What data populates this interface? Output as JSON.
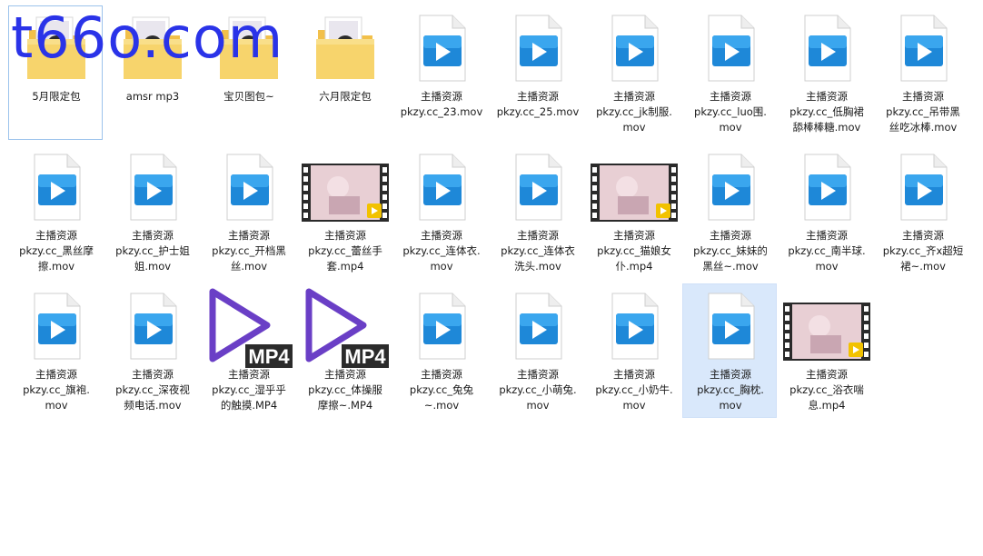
{
  "watermark": "t66o.com",
  "colors": {
    "selection": "#d9e8fb",
    "video_blue": "#1e88d8",
    "mp4_purple": "#6a3fc6",
    "folder": "#f6cf62",
    "watermark": "#2a33e8"
  },
  "items": [
    {
      "type": "folder",
      "lines": [
        "5月限定包"
      ],
      "focus": true
    },
    {
      "type": "folder",
      "lines": [
        "amsr mp3"
      ]
    },
    {
      "type": "folder",
      "lines": [
        "宝贝图包~"
      ]
    },
    {
      "type": "folder",
      "lines": [
        "六月限定包"
      ]
    },
    {
      "type": "video",
      "lines": [
        "主播资源",
        "pkzy.cc_23.mov"
      ]
    },
    {
      "type": "video",
      "lines": [
        "主播资源",
        "pkzy.cc_25.mov"
      ]
    },
    {
      "type": "video",
      "lines": [
        "主播资源",
        "pkzy.cc_jk制服.",
        "mov"
      ]
    },
    {
      "type": "video",
      "lines": [
        "主播资源",
        "pkzy.cc_luo围.",
        "mov"
      ]
    },
    {
      "type": "video",
      "lines": [
        "主播资源",
        "pkzy.cc_低胸裙",
        "舔棒棒糖.mov"
      ]
    },
    {
      "type": "video",
      "lines": [
        "主播资源",
        "pkzy.cc_吊带黑",
        "丝吃冰棒.mov"
      ]
    },
    {
      "type": "video",
      "lines": [
        "主播资源",
        "pkzy.cc_黑丝摩",
        "擦.mov"
      ]
    },
    {
      "type": "video",
      "lines": [
        "主播资源",
        "pkzy.cc_护士姐",
        "姐.mov"
      ]
    },
    {
      "type": "video",
      "lines": [
        "主播资源",
        "pkzy.cc_开档黑",
        "丝.mov"
      ]
    },
    {
      "type": "thumb",
      "lines": [
        "主播资源",
        "pkzy.cc_蕾丝手",
        "套.mp4"
      ]
    },
    {
      "type": "video",
      "lines": [
        "主播资源",
        "pkzy.cc_连体衣.",
        "mov"
      ]
    },
    {
      "type": "video",
      "lines": [
        "主播资源",
        "pkzy.cc_连体衣",
        "洗头.mov"
      ]
    },
    {
      "type": "thumb",
      "lines": [
        "主播资源",
        "pkzy.cc_猫娘女",
        "仆.mp4"
      ]
    },
    {
      "type": "video",
      "lines": [
        "主播资源",
        "pkzy.cc_妹妹的",
        "黑丝~.mov"
      ]
    },
    {
      "type": "video",
      "lines": [
        "主播资源",
        "pkzy.cc_南半球.",
        "mov"
      ]
    },
    {
      "type": "video",
      "lines": [
        "主播资源",
        "pkzy.cc_齐x超短",
        "裙~.mov"
      ]
    },
    {
      "type": "video",
      "lines": [
        "主播资源",
        "pkzy.cc_旗袍.",
        "mov"
      ]
    },
    {
      "type": "video",
      "lines": [
        "主播资源",
        "pkzy.cc_深夜视",
        "频电话.mov"
      ]
    },
    {
      "type": "mp4",
      "lines": [
        "主播资源",
        "pkzy.cc_湿乎乎",
        "的触摸.MP4"
      ]
    },
    {
      "type": "mp4",
      "lines": [
        "主播资源",
        "pkzy.cc_体操服",
        "摩擦~.MP4"
      ]
    },
    {
      "type": "video",
      "lines": [
        "主播资源",
        "pkzy.cc_兔兔",
        "~.mov"
      ]
    },
    {
      "type": "video",
      "lines": [
        "主播资源",
        "pkzy.cc_小萌兔.",
        "mov"
      ]
    },
    {
      "type": "video",
      "lines": [
        "主播资源",
        "pkzy.cc_小奶牛.",
        "mov"
      ]
    },
    {
      "type": "video",
      "lines": [
        "主播资源",
        "pkzy.cc_胸枕.",
        "mov"
      ],
      "selected": true
    },
    {
      "type": "thumb",
      "lines": [
        "主播资源",
        "pkzy.cc_浴衣喘",
        "息.mp4"
      ]
    }
  ]
}
